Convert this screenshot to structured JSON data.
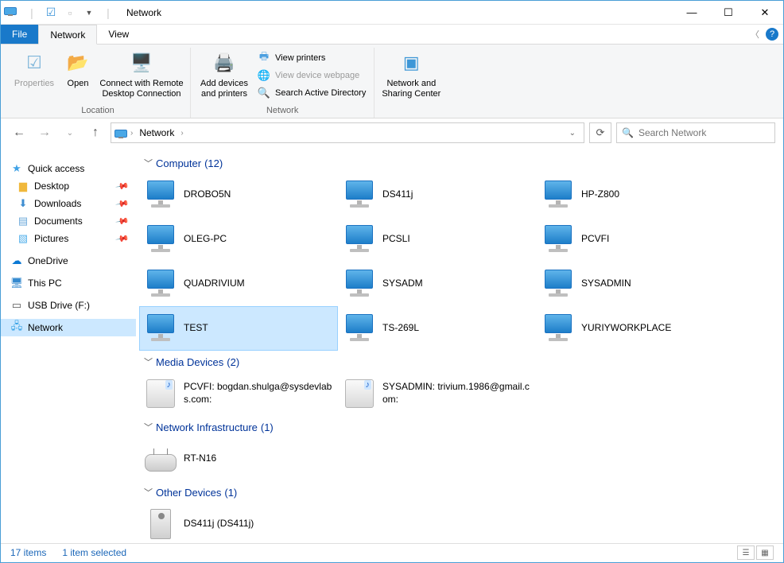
{
  "window": {
    "title": "Network"
  },
  "tabs": {
    "file": "File",
    "network": "Network",
    "view": "View"
  },
  "ribbon": {
    "properties": "Properties",
    "open": "Open",
    "remote": "Connect with Remote Desktop Connection",
    "group_location": "Location",
    "add_devices": "Add devices and printers",
    "view_printers": "View printers",
    "view_webpage": "View device webpage",
    "search_ad": "Search Active Directory",
    "group_network": "Network",
    "sharing_center": "Network and Sharing Center"
  },
  "address": {
    "crumb1": "Network"
  },
  "search": {
    "placeholder": "Search Network"
  },
  "sidebar": {
    "quick": "Quick access",
    "desktop": "Desktop",
    "downloads": "Downloads",
    "documents": "Documents",
    "pictures": "Pictures",
    "onedrive": "OneDrive",
    "thispc": "This PC",
    "usb": "USB Drive (F:)",
    "network": "Network"
  },
  "groups": {
    "computer": {
      "label": "Computer",
      "count": "(12)",
      "items": [
        "DROBO5N",
        "DS411j",
        "HP-Z800",
        "OLEG-PC",
        "PCSLI",
        "PCVFI",
        "QUADRIVIUM",
        "SYSADM",
        "SYSADMIN",
        "TEST",
        "TS-269L",
        "YURIYWORKPLACE"
      ],
      "selected_index": 9
    },
    "media": {
      "label": "Media Devices",
      "count": "(2)",
      "items": [
        "PCVFI: bogdan.shulga@sysdevlabs.com:",
        "SYSADMIN: trivium.1986@gmail.com:"
      ]
    },
    "infra": {
      "label": "Network Infrastructure",
      "count": "(1)",
      "items": [
        "RT-N16"
      ]
    },
    "other": {
      "label": "Other Devices",
      "count": "(1)",
      "items": [
        "DS411j (DS411j)"
      ]
    }
  },
  "status": {
    "count": "17 items",
    "selected": "1 item selected"
  }
}
